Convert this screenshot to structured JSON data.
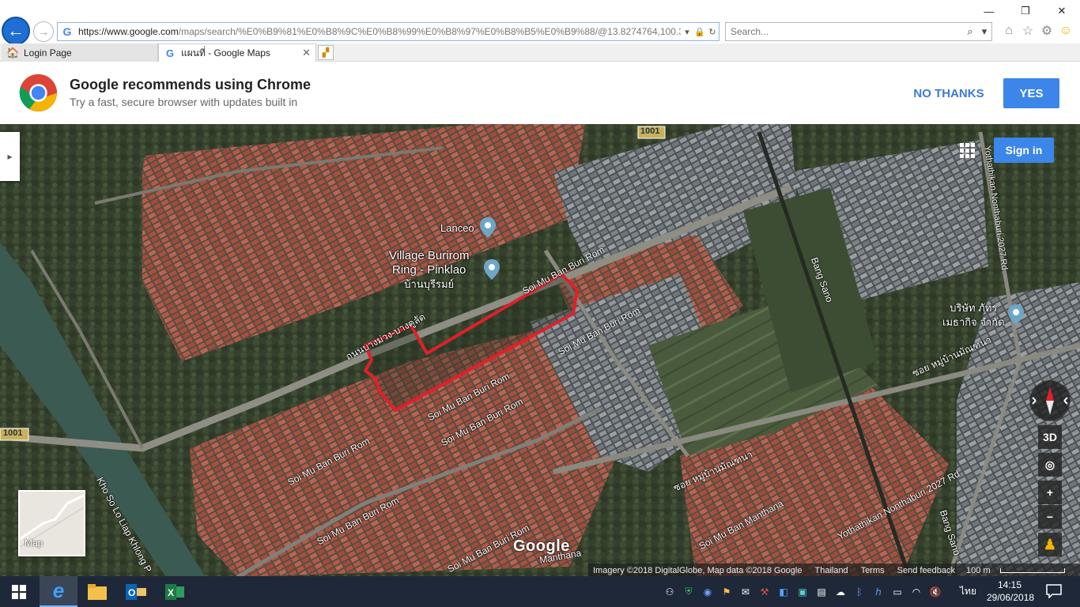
{
  "browser": {
    "url_main": "https://www.google.com",
    "url_rest": "/maps/search/%E0%B9%81%E0%B8%9C%E0%B8%99%E0%B8%97%E0%B8%B5%E0%B9%88/@13.8274764,100.3967361,",
    "search_placeholder": "Search...",
    "tabs": [
      {
        "label": "Login Page"
      },
      {
        "label": "แผนที่ - Google Maps"
      }
    ]
  },
  "banner": {
    "title": "Google recommends using Chrome",
    "subtitle": "Try a fast, secure browser with updates built in",
    "no_thanks": "NO THANKS",
    "yes": "YES"
  },
  "map": {
    "sign_in": "Sign in",
    "places": {
      "lanceo": "Lanceo",
      "village_line1": "Village Burirom",
      "village_line2": "Ring - Pinklao",
      "village_thai": "บ้านบุรีรมย์",
      "company_line1": "บริษัท ภัทร",
      "company_line2": "เมธากิจ จำกัด"
    },
    "roads": {
      "r1001_top": "1001",
      "r1001_left": "1001",
      "soi_buri_rom": "Soi Mu Ban Buri Rom",
      "thai_road_left": "ถนนบางม่วง-บางคูลัด",
      "thai_mu_ban": "ซอย หมู่บ้านมัณฑนา",
      "thai_right": "ซอย หมู่บ้านมัณฑนา",
      "bang_sano": "Bang Sano",
      "yothathikan": "Yothathikan Nonthaburi 2027 Rd",
      "khlong": "Kho So Lo Liap Khlong P",
      "manthana": "Soi Mu Ban Manthana",
      "manthana_short": "Manthana"
    },
    "controls": {
      "three_d": "3D",
      "zoom_in": "+",
      "zoom_out": "−"
    },
    "minimap_label": "Map",
    "logo": "Google",
    "footer": {
      "imagery": "Imagery ©2018 DigitalGlobe, Map data ©2018 Google",
      "country": "Thailand",
      "terms": "Terms",
      "feedback": "Send feedback",
      "scale": "100 m"
    }
  },
  "taskbar": {
    "lang": "ไทย",
    "time": "14:15",
    "date": "29/06/2018"
  },
  "colors": {
    "accent_blue": "#3b86e8",
    "parcel_red": "#e0202a",
    "taskbar": "#1e2838"
  }
}
